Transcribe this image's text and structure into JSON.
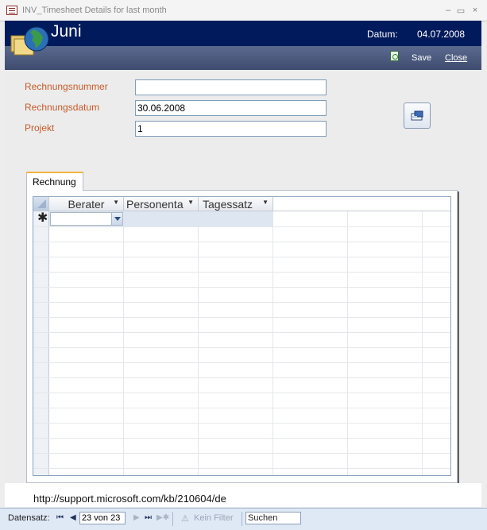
{
  "window": {
    "title": "INV_Timesheet Details for last month",
    "minimize": "–",
    "maximize": "▭",
    "close": "×"
  },
  "header": {
    "title": "Juni",
    "datum_label": "Datum:",
    "datum_value": "04.07.2008"
  },
  "toolbar": {
    "save_label": "Save",
    "close_label": "Close"
  },
  "form": {
    "fields": [
      {
        "label": "Rechnungsnummer",
        "value": ""
      },
      {
        "label": "Rechnungsdatum",
        "value": "30.06.2008"
      },
      {
        "label": "Projekt",
        "value": "1"
      }
    ]
  },
  "tabs": [
    {
      "label": "Rechnung"
    }
  ],
  "datasheet": {
    "columns": [
      "Berater",
      "Personenta",
      "Tagessatz"
    ],
    "new_row_marker": "✱"
  },
  "footer": {
    "url": "http://support.microsoft.com/kb/210604/de"
  },
  "navigation": {
    "label": "Datensatz:",
    "first": "⏮",
    "prev": "◀",
    "record": "23 von 23",
    "next": "▶",
    "last": "⏭",
    "new": "▶✱",
    "filter_label": "Kein Filter",
    "search_label": "Suchen"
  }
}
